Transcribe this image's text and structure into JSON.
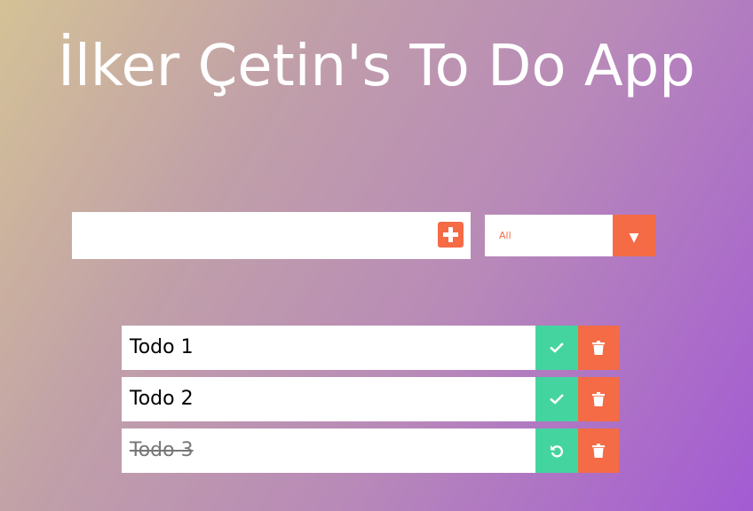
{
  "header": {
    "title": "İlker Çetin's To Do App"
  },
  "input": {
    "value": "",
    "placeholder": ""
  },
  "add_button": {
    "icon": "plus-square-icon"
  },
  "filter": {
    "selected": "All",
    "arrow": "▼"
  },
  "todos": [
    {
      "text": "Todo 1",
      "completed": false,
      "action_icon": "check-icon"
    },
    {
      "text": "Todo 2",
      "completed": false,
      "action_icon": "check-icon"
    },
    {
      "text": "Todo 3",
      "completed": true,
      "action_icon": "undo-icon"
    }
  ],
  "colors": {
    "accent": "#f46b45",
    "complete": "#44d4a0",
    "gradient_start": "#d4c296",
    "gradient_end": "#a35bd3"
  }
}
